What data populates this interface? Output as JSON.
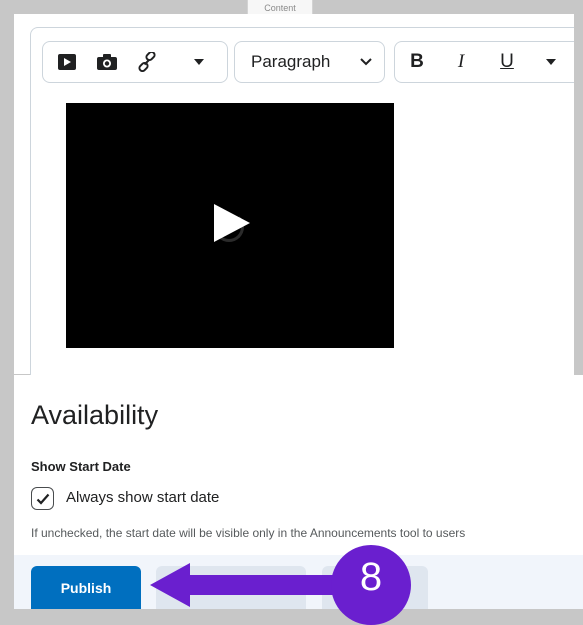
{
  "editor": {
    "tab_label": "Content",
    "toolbar": {
      "insert_group": [
        "video-icon",
        "camera-icon",
        "link-icon",
        "caret-down-icon"
      ],
      "format_select": {
        "selected": "Paragraph"
      },
      "text_format": {
        "bold": "B",
        "italic": "I",
        "underline": "U"
      }
    },
    "video": {
      "state": "paused"
    }
  },
  "availability": {
    "title": "Availability",
    "show_start_date_label": "Show Start Date",
    "always_show": {
      "label": "Always show start date",
      "checked": true
    },
    "help_text": "If unchecked, the start date will be visible only in the Announcements tool to users"
  },
  "footer": {
    "publish_label": "Publish"
  },
  "annotation": {
    "step_number": "8",
    "color": "#6a1fcf"
  },
  "colors": {
    "primary": "#006fbf",
    "annotation": "#6a1fcf",
    "frame": "#c7c7c7"
  }
}
